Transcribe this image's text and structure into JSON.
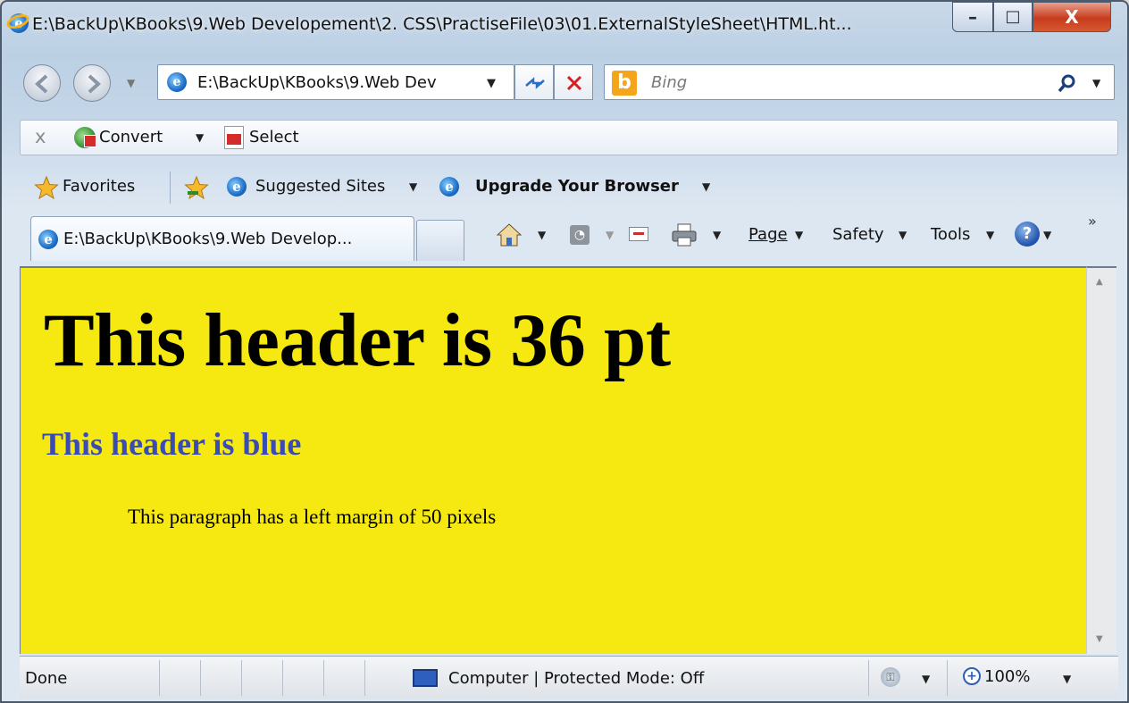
{
  "window": {
    "title": "E:\\BackUp\\KBooks\\9.Web Developement\\2. CSS\\PractiseFile\\03\\01.ExternalStyleSheet\\HTML.ht...",
    "minimize_glyph": "–",
    "maximize_glyph": "□",
    "close_glyph": "X"
  },
  "navbar": {
    "address": "E:\\BackUp\\KBooks\\9.Web Dev",
    "search_placeholder": "Bing"
  },
  "toolbar": {
    "close_glyph": "x",
    "convert_label": "Convert",
    "select_label": "Select"
  },
  "favorites_bar": {
    "favorites_label": "Favorites",
    "suggested_sites_label": "Suggested Sites",
    "upgrade_label": "Upgrade Your Browser"
  },
  "tab": {
    "label": "E:\\BackUp\\KBooks\\9.Web Develop..."
  },
  "command_bar": {
    "page_label": "Page",
    "safety_label": "Safety",
    "tools_label": "Tools",
    "chevron": "»"
  },
  "page": {
    "heading1": "This header is 36 pt",
    "heading2": "This header is blue",
    "paragraph": "This paragraph has a left margin of 50 pixels",
    "background_color": "#f5e911",
    "heading2_color": "#3a4bb4"
  },
  "status_bar": {
    "status_text": "Done",
    "zone_text": "Computer | Protected Mode: Off",
    "zoom_text": "100%"
  },
  "icons": {
    "ie": "ie-logo-icon",
    "bing": "bing-logo-icon",
    "search": "magnifier-icon",
    "home": "home-icon",
    "feeds": "rss-icon",
    "mail": "mail-icon",
    "print": "printer-icon",
    "help": "help-icon"
  }
}
